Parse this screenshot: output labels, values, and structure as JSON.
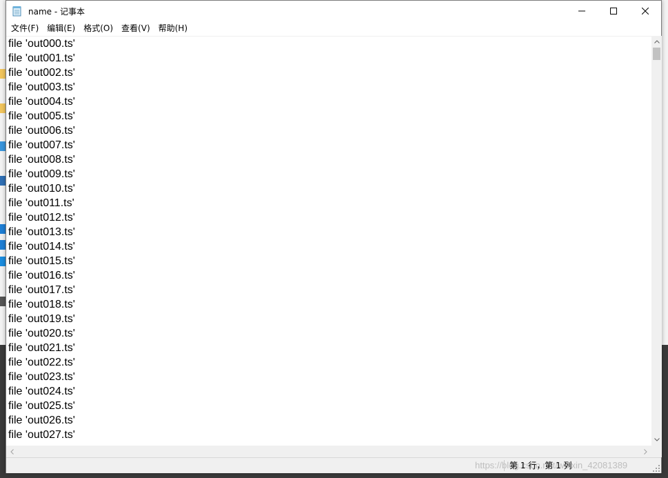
{
  "window": {
    "title": "name - 记事本"
  },
  "menu": [
    {
      "label": "文件(F)"
    },
    {
      "label": "编辑(E)"
    },
    {
      "label": "格式(O)"
    },
    {
      "label": "查看(V)"
    },
    {
      "label": "帮助(H)"
    }
  ],
  "document": {
    "lines": [
      "file 'out000.ts'",
      "file 'out001.ts'",
      "file 'out002.ts'",
      "file 'out003.ts'",
      "file 'out004.ts'",
      "file 'out005.ts'",
      "file 'out006.ts'",
      "file 'out007.ts'",
      "file 'out008.ts'",
      "file 'out009.ts'",
      "file 'out010.ts'",
      "file 'out011.ts'",
      "file 'out012.ts'",
      "file 'out013.ts'",
      "file 'out014.ts'",
      "file 'out015.ts'",
      "file 'out016.ts'",
      "file 'out017.ts'",
      "file 'out018.ts'",
      "file 'out019.ts'",
      "file 'out020.ts'",
      "file 'out021.ts'",
      "file 'out022.ts'",
      "file 'out023.ts'",
      "file 'out024.ts'",
      "file 'out025.ts'",
      "file 'out026.ts'",
      "file 'out027.ts'"
    ]
  },
  "statusbar": {
    "position": "第 1 行，第 1 列",
    "watermark": "https://blog.csdn.net/weixin_42081389"
  },
  "colors": {
    "window_bg": "#ffffff",
    "chrome_bg": "#f0f0f0",
    "scroll_thumb": "#c2c2c2",
    "text": "#000000"
  },
  "icons": {
    "app": "notepad-icon",
    "minimize": "minimize-icon",
    "maximize": "maximize-icon",
    "close": "close-icon"
  }
}
